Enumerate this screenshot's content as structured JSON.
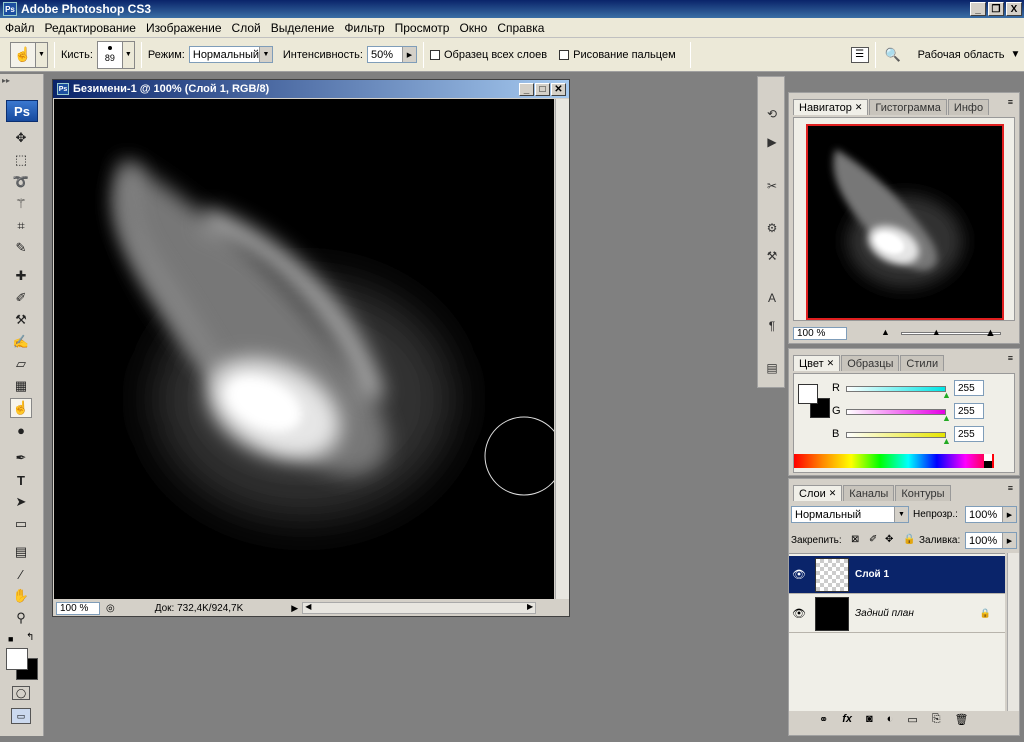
{
  "app": {
    "title": "Adobe Photoshop CS3",
    "logo": "Ps"
  },
  "window_controls": {
    "minimize": "_",
    "restore": "❐",
    "close": "X"
  },
  "menu": [
    "Файл",
    "Редактирование",
    "Изображение",
    "Слой",
    "Выделение",
    "Фильтр",
    "Просмотр",
    "Окно",
    "Справка"
  ],
  "options": {
    "brush_label": "Кисть:",
    "brush_size": "89",
    "mode_label": "Режим:",
    "mode_value": "Нормальный",
    "strength_label": "Интенсивность:",
    "strength_value": "50%",
    "sample_all_label": "Образец всех слоев",
    "finger_paint_label": "Рисование пальцем",
    "workspace_label": "Рабочая область"
  },
  "tool_icons": [
    "move-icon",
    "marquee-icon",
    "lasso-icon",
    "magic-wand-icon",
    "crop-icon",
    "eyedropper-icon",
    "healing-icon",
    "brush-icon",
    "stamp-icon",
    "history-brush-icon",
    "eraser-icon",
    "gradient-icon",
    "smudge-icon",
    "dodge-icon",
    "pen-icon",
    "type-icon",
    "path-select-icon",
    "shape-icon",
    "notes-icon",
    "eyedropper-icon",
    "hand-icon",
    "zoom-icon"
  ],
  "document": {
    "title": "Безимени-1 @ 100% (Слой 1, RGB/8)",
    "zoom": "100 %",
    "doc_info": "Док: 732,4K/924,7K"
  },
  "navigator": {
    "tabs": [
      "Навигатор",
      "Гистограмма",
      "Инфо"
    ],
    "zoom": "100 %",
    "zoom_level": 0.35
  },
  "color": {
    "tabs": [
      "Цвет",
      "Образцы",
      "Стили"
    ],
    "channels": [
      {
        "label": "R",
        "value": "255",
        "color": "#00e5e5"
      },
      {
        "label": "G",
        "value": "255",
        "color": "#e500e5"
      },
      {
        "label": "B",
        "value": "255",
        "color": "#e5e500"
      }
    ],
    "foreground": "#ffffff",
    "background": "#000000"
  },
  "layers": {
    "tabs": [
      "Слои",
      "Каналы",
      "Контуры"
    ],
    "blend_mode": "Нормальный",
    "opacity_label": "Непрозр.:",
    "opacity_value": "100%",
    "lock_label": "Закрепить:",
    "fill_label": "Заливка:",
    "fill_value": "100%",
    "items": [
      {
        "name": "Слой 1",
        "selected": true
      },
      {
        "name": "Задний план",
        "selected": false,
        "locked": true
      }
    ]
  },
  "colors": {
    "selection": "#0a246a",
    "title_start": "#0a246a",
    "title_end": "#a6caf0",
    "workspace_bg": "#808080"
  }
}
